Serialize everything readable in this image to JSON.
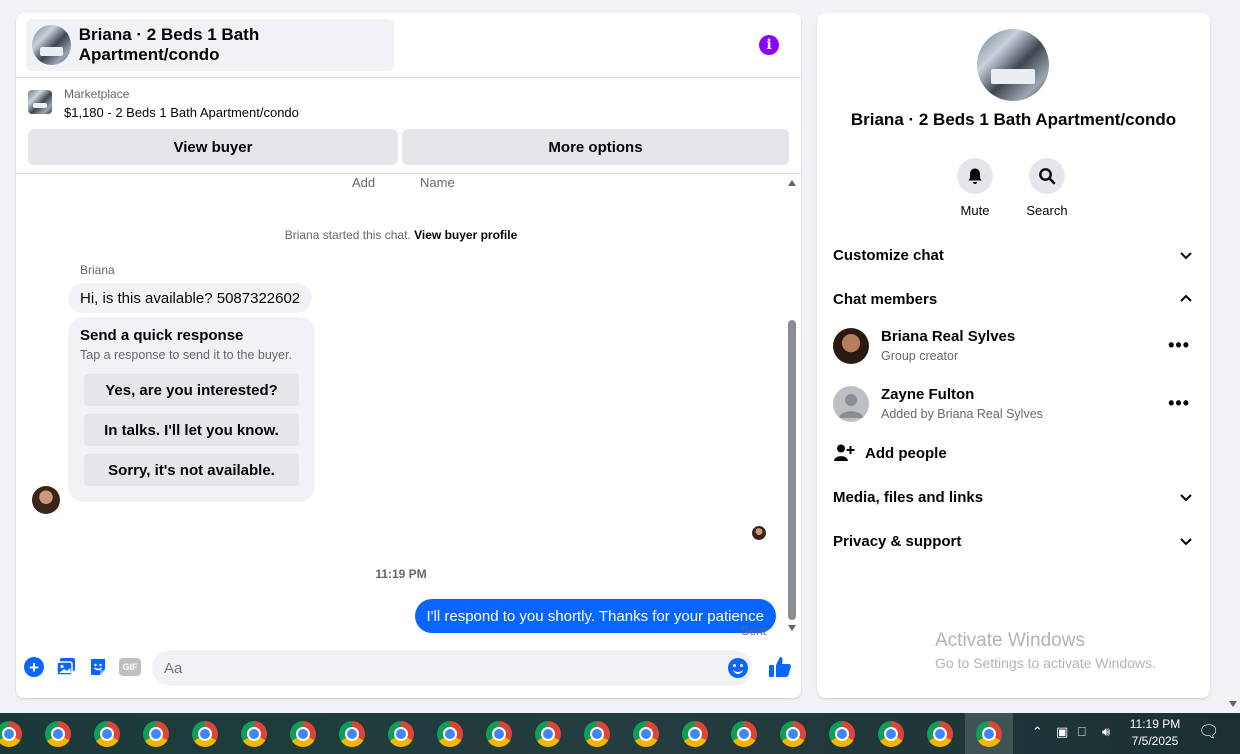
{
  "chat": {
    "title": "Briana · 2 Beds 1 Bath Apartment/condo",
    "listing": {
      "source": "Marketplace",
      "price_title": "$1,180 - 2 Beds 1 Bath Apartment/condo"
    },
    "buttons": {
      "view_buyer": "View buyer",
      "more_options": "More options"
    },
    "cut_labels": [
      "Add",
      "Name"
    ],
    "started_prefix": "Briana started this chat.",
    "started_link": "View buyer profile",
    "sender": "Briana",
    "incoming_message": "Hi, is this available? 5087322602",
    "quick_response": {
      "title": "Send a quick response",
      "subtitle": "Tap a response to send it to the buyer.",
      "options": [
        "Yes, are you interested?",
        "In talks. I'll let you know.",
        "Sorry, it's not available."
      ]
    },
    "timestamp": "11:19 PM",
    "outgoing_message": "I'll respond to you shortly. Thanks for your patience",
    "status": "Sent",
    "composer_placeholder": "Aa",
    "gif_label": "GIF"
  },
  "info": {
    "name": "Briana · 2 Beds 1 Bath Apartment/condo",
    "actions": {
      "mute": "Mute",
      "search": "Search"
    },
    "sections": {
      "customize": "Customize chat",
      "members": "Chat members",
      "media": "Media, files and links",
      "privacy": "Privacy & support"
    },
    "members": [
      {
        "name": "Briana Real Sylves",
        "role": "Group creator"
      },
      {
        "name": "Zayne Fulton",
        "role": "Added by Briana Real Sylves"
      }
    ],
    "add_people": "Add people"
  },
  "watermark": {
    "line1": "Activate Windows",
    "line2": "Go to Settings to activate Windows."
  },
  "taskbar": {
    "time": "11:19 PM",
    "date": "7/5/2025"
  },
  "colors": {
    "accent": "#0866ff",
    "info": "#8a05ff",
    "bubble_in": "#f0f2f5"
  }
}
